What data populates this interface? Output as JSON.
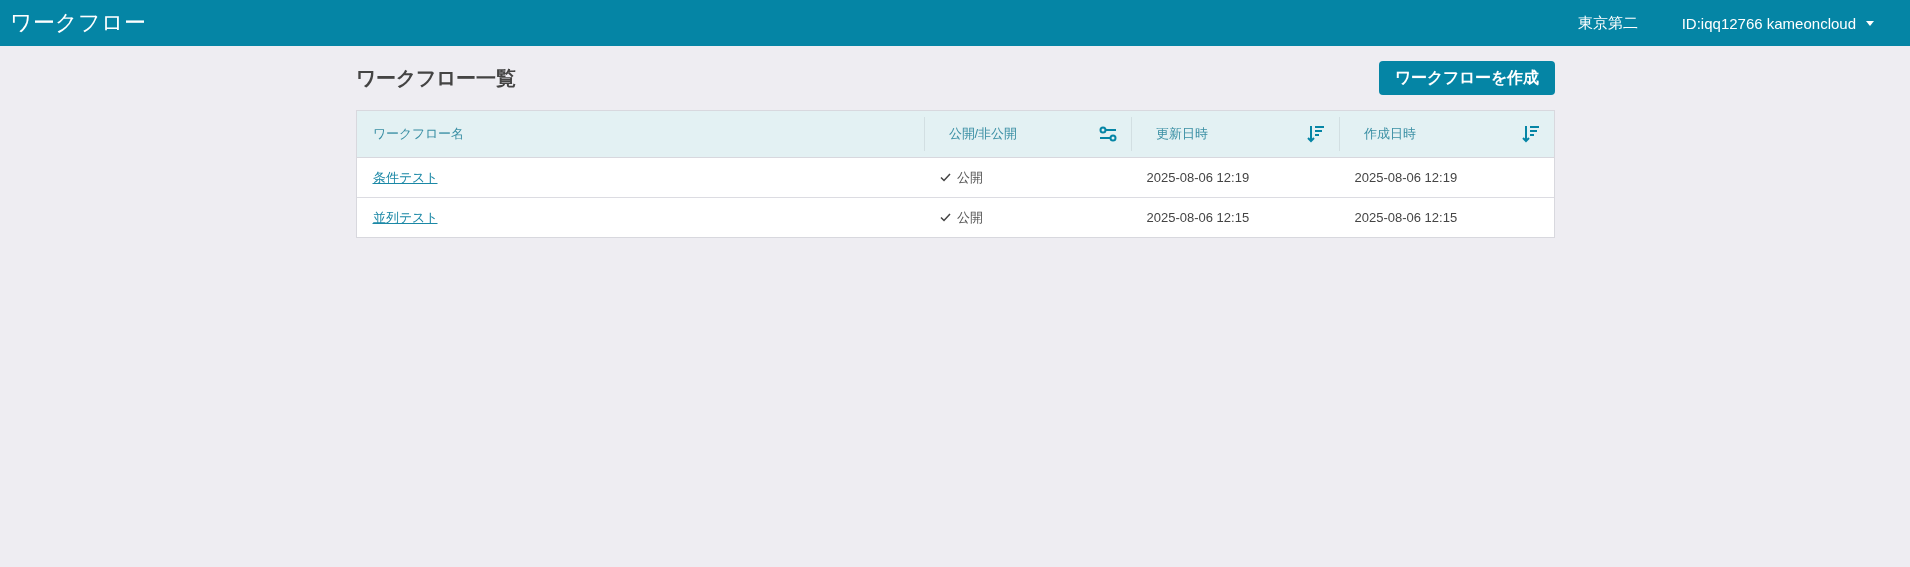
{
  "header": {
    "title": "ワークフロー",
    "location": "東京第二",
    "user": "ID:iqq12766 kameoncloud"
  },
  "page": {
    "heading": "ワークフロー一覧",
    "create_button": "ワークフローを作成"
  },
  "table": {
    "columns": [
      {
        "label": "ワークフロー名"
      },
      {
        "label": "公開/非公開",
        "kind": "filter"
      },
      {
        "label": "更新日時",
        "kind": "sort"
      },
      {
        "label": "作成日時",
        "kind": "sort"
      }
    ],
    "rows": [
      {
        "name": "条件テスト",
        "public": true,
        "visibility": "公開",
        "updated": "2025-08-06 12:19",
        "created": "2025-08-06 12:19"
      },
      {
        "name": "並列テスト",
        "public": true,
        "visibility": "公開",
        "updated": "2025-08-06 12:15",
        "created": "2025-08-06 12:15"
      }
    ]
  }
}
